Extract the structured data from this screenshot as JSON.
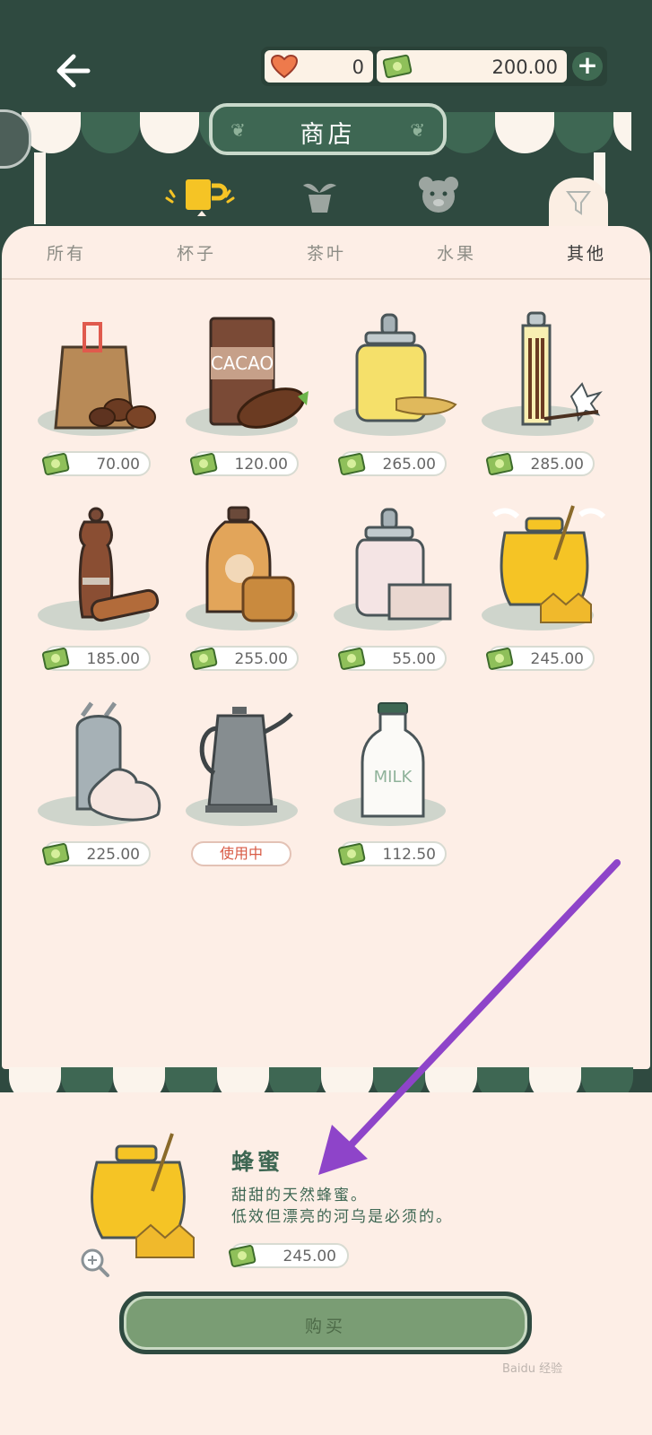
{
  "header": {
    "hearts_value": "0",
    "money_value": "200.00",
    "plus_label": "+",
    "title": "商店"
  },
  "tabs": [
    {
      "label": "所有"
    },
    {
      "label": "杯子"
    },
    {
      "label": "茶叶"
    },
    {
      "label": "水果"
    },
    {
      "label": "其他",
      "active": true
    }
  ],
  "items": [
    {
      "name": "coffee-beans",
      "price": "70.00"
    },
    {
      "name": "cacao",
      "price": "120.00",
      "text": "CACAO"
    },
    {
      "name": "ginger-jar",
      "price": "265.00"
    },
    {
      "name": "vanilla",
      "price": "285.00"
    },
    {
      "name": "cinnamon-grinder",
      "price": "185.00"
    },
    {
      "name": "maple-syrup",
      "price": "255.00"
    },
    {
      "name": "sugar-cubes",
      "price": "55.00"
    },
    {
      "name": "honey",
      "price": "245.00"
    },
    {
      "name": "whipped-cream",
      "price": "225.00"
    },
    {
      "name": "kettle",
      "status": "使用中"
    },
    {
      "name": "milk",
      "price": "112.50",
      "text": "MILK"
    }
  ],
  "detail": {
    "name": "蜂蜜",
    "desc_line1": "甜甜的天然蜂蜜。",
    "desc_line2": "低效但漂亮的河乌是必须的。",
    "price": "245.00",
    "buy_label": "购买"
  },
  "watermark": "Baidu 经验",
  "colors": {
    "dark_green": "#2f4a40",
    "awning_green": "#3e6753",
    "panel_bg": "#fdeee6",
    "arrow_purple": "#8e44c9",
    "using_red": "#d85a44"
  }
}
